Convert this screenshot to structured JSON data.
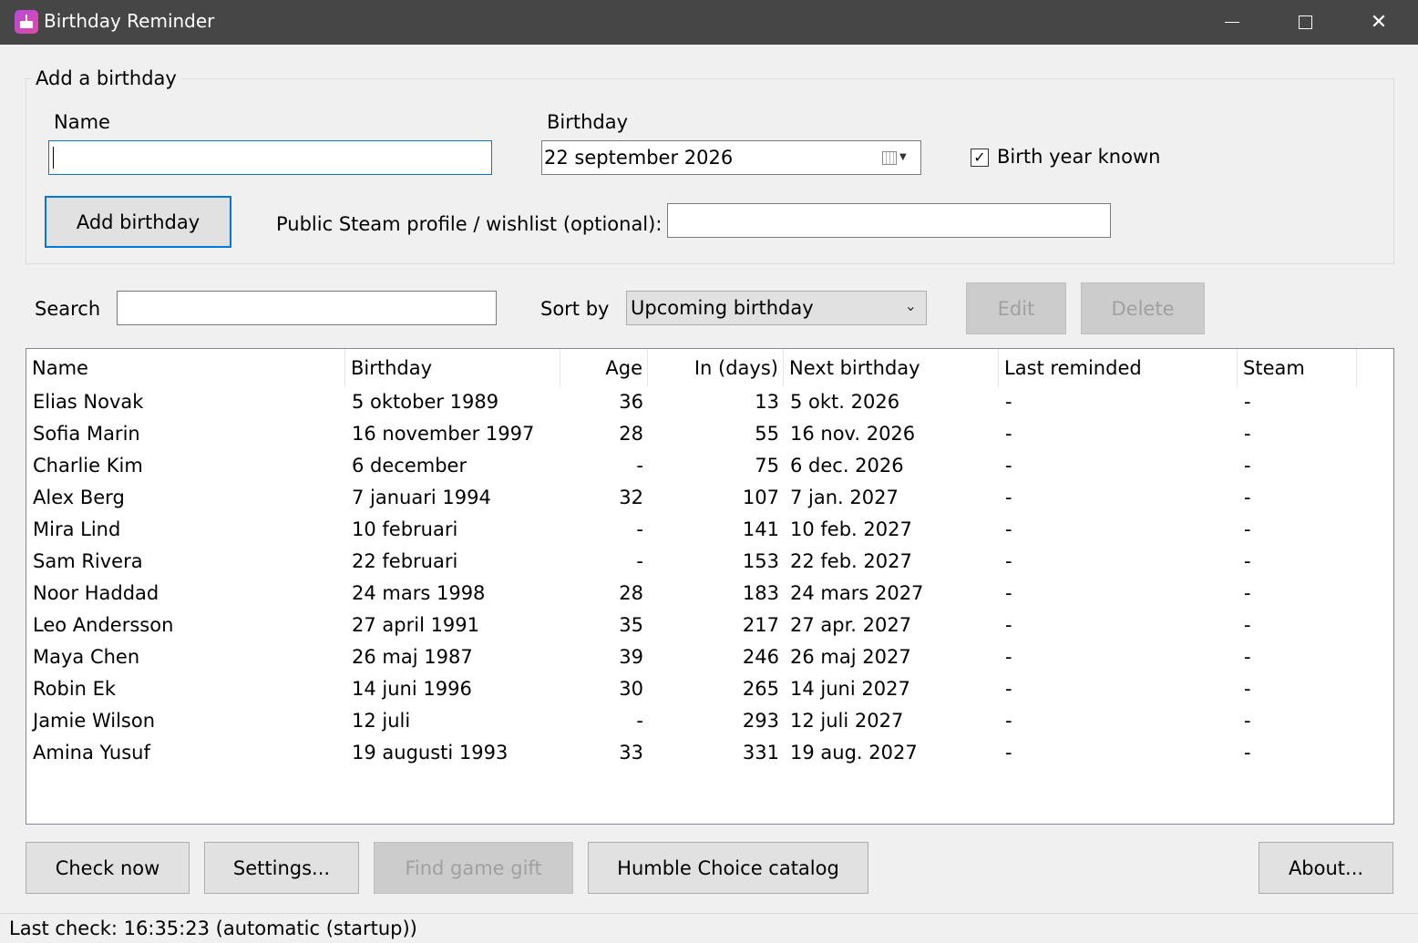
{
  "window": {
    "title": "Birthday Reminder",
    "icon": "birthday-cake-icon",
    "controls": {
      "minimize": "minimize-icon",
      "maximize": "maximize-icon",
      "close": "✕"
    }
  },
  "add_group": {
    "legend": "Add a birthday",
    "name_label": "Name",
    "name_value": "",
    "birthday_label": "Birthday",
    "birthday_value": "22 september 2026",
    "birth_year_known_label": "Birth year known",
    "birth_year_known_mark": "✓",
    "add_button": "Add birthday",
    "steam_label": "Public Steam profile / wishlist (optional):",
    "steam_value": ""
  },
  "toolbar": {
    "search_label": "Search",
    "search_value": "",
    "sort_label": "Sort by",
    "sort_value": "Upcoming birthday",
    "sort_arrow": "⌄",
    "edit_button": "Edit",
    "delete_button": "Delete"
  },
  "table": {
    "columns": [
      "Name",
      "Birthday",
      "Age",
      "In (days)",
      "Next birthday",
      "Last reminded",
      "Steam"
    ],
    "rows": [
      [
        "Elias Novak",
        "5 oktober 1989",
        "36",
        "13",
        "5 okt. 2026",
        "-",
        "-"
      ],
      [
        "Sofia Marin",
        "16 november 1997",
        "28",
        "55",
        "16 nov. 2026",
        "-",
        "-"
      ],
      [
        "Charlie Kim",
        "6 december",
        "-",
        "75",
        "6 dec. 2026",
        "-",
        "-"
      ],
      [
        "Alex Berg",
        "7 januari 1994",
        "32",
        "107",
        "7 jan. 2027",
        "-",
        "-"
      ],
      [
        "Mira Lind",
        "10 februari",
        "-",
        "141",
        "10 feb. 2027",
        "-",
        "-"
      ],
      [
        "Sam Rivera",
        "22 februari",
        "-",
        "153",
        "22 feb. 2027",
        "-",
        "-"
      ],
      [
        "Noor Haddad",
        "24 mars 1998",
        "28",
        "183",
        "24 mars 2027",
        "-",
        "-"
      ],
      [
        "Leo Andersson",
        "27 april 1991",
        "35",
        "217",
        "27 apr. 2027",
        "-",
        "-"
      ],
      [
        "Maya Chen",
        "26 maj 1987",
        "39",
        "246",
        "26 maj 2027",
        "-",
        "-"
      ],
      [
        "Robin Ek",
        "14 juni 1996",
        "30",
        "265",
        "14 juni 2027",
        "-",
        "-"
      ],
      [
        "Jamie Wilson",
        "12 juli",
        "-",
        "293",
        "12 juli 2027",
        "-",
        "-"
      ],
      [
        "Amina Yusuf",
        "19 augusti 1993",
        "33",
        "331",
        "19 aug. 2027",
        "-",
        "-"
      ]
    ]
  },
  "bottom_buttons": {
    "check_now": "Check now",
    "settings": "Settings...",
    "find_game_gift": "Find game gift",
    "humble_choice": "Humble Choice catalog",
    "about": "About..."
  },
  "status": {
    "text": "Last check: 16:35:23 (automatic (startup))"
  },
  "colors": {
    "titlebar": "#464646",
    "accent": "#0078d7",
    "window_bg": "#f0f0f0"
  }
}
